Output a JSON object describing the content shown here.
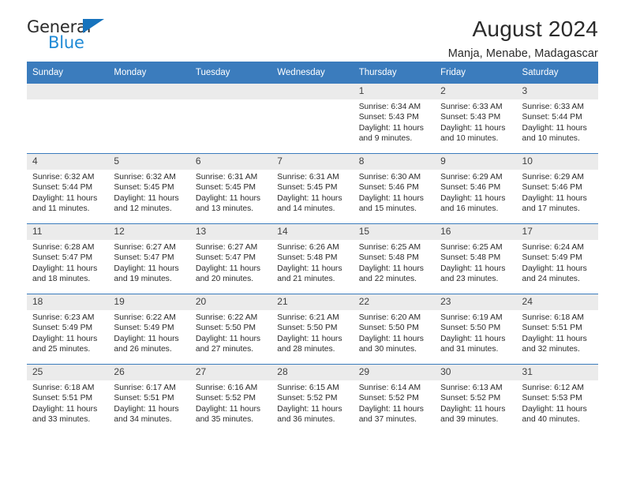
{
  "brand": {
    "name_part1": "General",
    "name_part2": "Blue",
    "accent_color": "#1f8ad6",
    "triangle_color": "#1673bd"
  },
  "header": {
    "title": "August 2024",
    "subtitle": "Manja, Menabe, Madagascar"
  },
  "theme": {
    "header_row_color": "#3b7cbd",
    "daynum_band_color": "#ebebeb",
    "text_color": "#2b2b2b"
  },
  "weekday_headers": [
    "Sunday",
    "Monday",
    "Tuesday",
    "Wednesday",
    "Thursday",
    "Friday",
    "Saturday"
  ],
  "labels": {
    "sunrise_prefix": "Sunrise:",
    "sunset_prefix": "Sunset:",
    "daylight_prefix": "Daylight:"
  },
  "weeks": [
    [
      {
        "day": "",
        "empty": true
      },
      {
        "day": "",
        "empty": true
      },
      {
        "day": "",
        "empty": true
      },
      {
        "day": "",
        "empty": true
      },
      {
        "day": "1",
        "sunrise": "Sunrise: 6:34 AM",
        "sunset": "Sunset: 5:43 PM",
        "daylight_line1": "Daylight: 11 hours",
        "daylight_line2": "and 9 minutes."
      },
      {
        "day": "2",
        "sunrise": "Sunrise: 6:33 AM",
        "sunset": "Sunset: 5:43 PM",
        "daylight_line1": "Daylight: 11 hours",
        "daylight_line2": "and 10 minutes."
      },
      {
        "day": "3",
        "sunrise": "Sunrise: 6:33 AM",
        "sunset": "Sunset: 5:44 PM",
        "daylight_line1": "Daylight: 11 hours",
        "daylight_line2": "and 10 minutes."
      }
    ],
    [
      {
        "day": "4",
        "sunrise": "Sunrise: 6:32 AM",
        "sunset": "Sunset: 5:44 PM",
        "daylight_line1": "Daylight: 11 hours",
        "daylight_line2": "and 11 minutes."
      },
      {
        "day": "5",
        "sunrise": "Sunrise: 6:32 AM",
        "sunset": "Sunset: 5:45 PM",
        "daylight_line1": "Daylight: 11 hours",
        "daylight_line2": "and 12 minutes."
      },
      {
        "day": "6",
        "sunrise": "Sunrise: 6:31 AM",
        "sunset": "Sunset: 5:45 PM",
        "daylight_line1": "Daylight: 11 hours",
        "daylight_line2": "and 13 minutes."
      },
      {
        "day": "7",
        "sunrise": "Sunrise: 6:31 AM",
        "sunset": "Sunset: 5:45 PM",
        "daylight_line1": "Daylight: 11 hours",
        "daylight_line2": "and 14 minutes."
      },
      {
        "day": "8",
        "sunrise": "Sunrise: 6:30 AM",
        "sunset": "Sunset: 5:46 PM",
        "daylight_line1": "Daylight: 11 hours",
        "daylight_line2": "and 15 minutes."
      },
      {
        "day": "9",
        "sunrise": "Sunrise: 6:29 AM",
        "sunset": "Sunset: 5:46 PM",
        "daylight_line1": "Daylight: 11 hours",
        "daylight_line2": "and 16 minutes."
      },
      {
        "day": "10",
        "sunrise": "Sunrise: 6:29 AM",
        "sunset": "Sunset: 5:46 PM",
        "daylight_line1": "Daylight: 11 hours",
        "daylight_line2": "and 17 minutes."
      }
    ],
    [
      {
        "day": "11",
        "sunrise": "Sunrise: 6:28 AM",
        "sunset": "Sunset: 5:47 PM",
        "daylight_line1": "Daylight: 11 hours",
        "daylight_line2": "and 18 minutes."
      },
      {
        "day": "12",
        "sunrise": "Sunrise: 6:27 AM",
        "sunset": "Sunset: 5:47 PM",
        "daylight_line1": "Daylight: 11 hours",
        "daylight_line2": "and 19 minutes."
      },
      {
        "day": "13",
        "sunrise": "Sunrise: 6:27 AM",
        "sunset": "Sunset: 5:47 PM",
        "daylight_line1": "Daylight: 11 hours",
        "daylight_line2": "and 20 minutes."
      },
      {
        "day": "14",
        "sunrise": "Sunrise: 6:26 AM",
        "sunset": "Sunset: 5:48 PM",
        "daylight_line1": "Daylight: 11 hours",
        "daylight_line2": "and 21 minutes."
      },
      {
        "day": "15",
        "sunrise": "Sunrise: 6:25 AM",
        "sunset": "Sunset: 5:48 PM",
        "daylight_line1": "Daylight: 11 hours",
        "daylight_line2": "and 22 minutes."
      },
      {
        "day": "16",
        "sunrise": "Sunrise: 6:25 AM",
        "sunset": "Sunset: 5:48 PM",
        "daylight_line1": "Daylight: 11 hours",
        "daylight_line2": "and 23 minutes."
      },
      {
        "day": "17",
        "sunrise": "Sunrise: 6:24 AM",
        "sunset": "Sunset: 5:49 PM",
        "daylight_line1": "Daylight: 11 hours",
        "daylight_line2": "and 24 minutes."
      }
    ],
    [
      {
        "day": "18",
        "sunrise": "Sunrise: 6:23 AM",
        "sunset": "Sunset: 5:49 PM",
        "daylight_line1": "Daylight: 11 hours",
        "daylight_line2": "and 25 minutes."
      },
      {
        "day": "19",
        "sunrise": "Sunrise: 6:22 AM",
        "sunset": "Sunset: 5:49 PM",
        "daylight_line1": "Daylight: 11 hours",
        "daylight_line2": "and 26 minutes."
      },
      {
        "day": "20",
        "sunrise": "Sunrise: 6:22 AM",
        "sunset": "Sunset: 5:50 PM",
        "daylight_line1": "Daylight: 11 hours",
        "daylight_line2": "and 27 minutes."
      },
      {
        "day": "21",
        "sunrise": "Sunrise: 6:21 AM",
        "sunset": "Sunset: 5:50 PM",
        "daylight_line1": "Daylight: 11 hours",
        "daylight_line2": "and 28 minutes."
      },
      {
        "day": "22",
        "sunrise": "Sunrise: 6:20 AM",
        "sunset": "Sunset: 5:50 PM",
        "daylight_line1": "Daylight: 11 hours",
        "daylight_line2": "and 30 minutes."
      },
      {
        "day": "23",
        "sunrise": "Sunrise: 6:19 AM",
        "sunset": "Sunset: 5:50 PM",
        "daylight_line1": "Daylight: 11 hours",
        "daylight_line2": "and 31 minutes."
      },
      {
        "day": "24",
        "sunrise": "Sunrise: 6:18 AM",
        "sunset": "Sunset: 5:51 PM",
        "daylight_line1": "Daylight: 11 hours",
        "daylight_line2": "and 32 minutes."
      }
    ],
    [
      {
        "day": "25",
        "sunrise": "Sunrise: 6:18 AM",
        "sunset": "Sunset: 5:51 PM",
        "daylight_line1": "Daylight: 11 hours",
        "daylight_line2": "and 33 minutes."
      },
      {
        "day": "26",
        "sunrise": "Sunrise: 6:17 AM",
        "sunset": "Sunset: 5:51 PM",
        "daylight_line1": "Daylight: 11 hours",
        "daylight_line2": "and 34 minutes."
      },
      {
        "day": "27",
        "sunrise": "Sunrise: 6:16 AM",
        "sunset": "Sunset: 5:52 PM",
        "daylight_line1": "Daylight: 11 hours",
        "daylight_line2": "and 35 minutes."
      },
      {
        "day": "28",
        "sunrise": "Sunrise: 6:15 AM",
        "sunset": "Sunset: 5:52 PM",
        "daylight_line1": "Daylight: 11 hours",
        "daylight_line2": "and 36 minutes."
      },
      {
        "day": "29",
        "sunrise": "Sunrise: 6:14 AM",
        "sunset": "Sunset: 5:52 PM",
        "daylight_line1": "Daylight: 11 hours",
        "daylight_line2": "and 37 minutes."
      },
      {
        "day": "30",
        "sunrise": "Sunrise: 6:13 AM",
        "sunset": "Sunset: 5:52 PM",
        "daylight_line1": "Daylight: 11 hours",
        "daylight_line2": "and 39 minutes."
      },
      {
        "day": "31",
        "sunrise": "Sunrise: 6:12 AM",
        "sunset": "Sunset: 5:53 PM",
        "daylight_line1": "Daylight: 11 hours",
        "daylight_line2": "and 40 minutes."
      }
    ]
  ]
}
